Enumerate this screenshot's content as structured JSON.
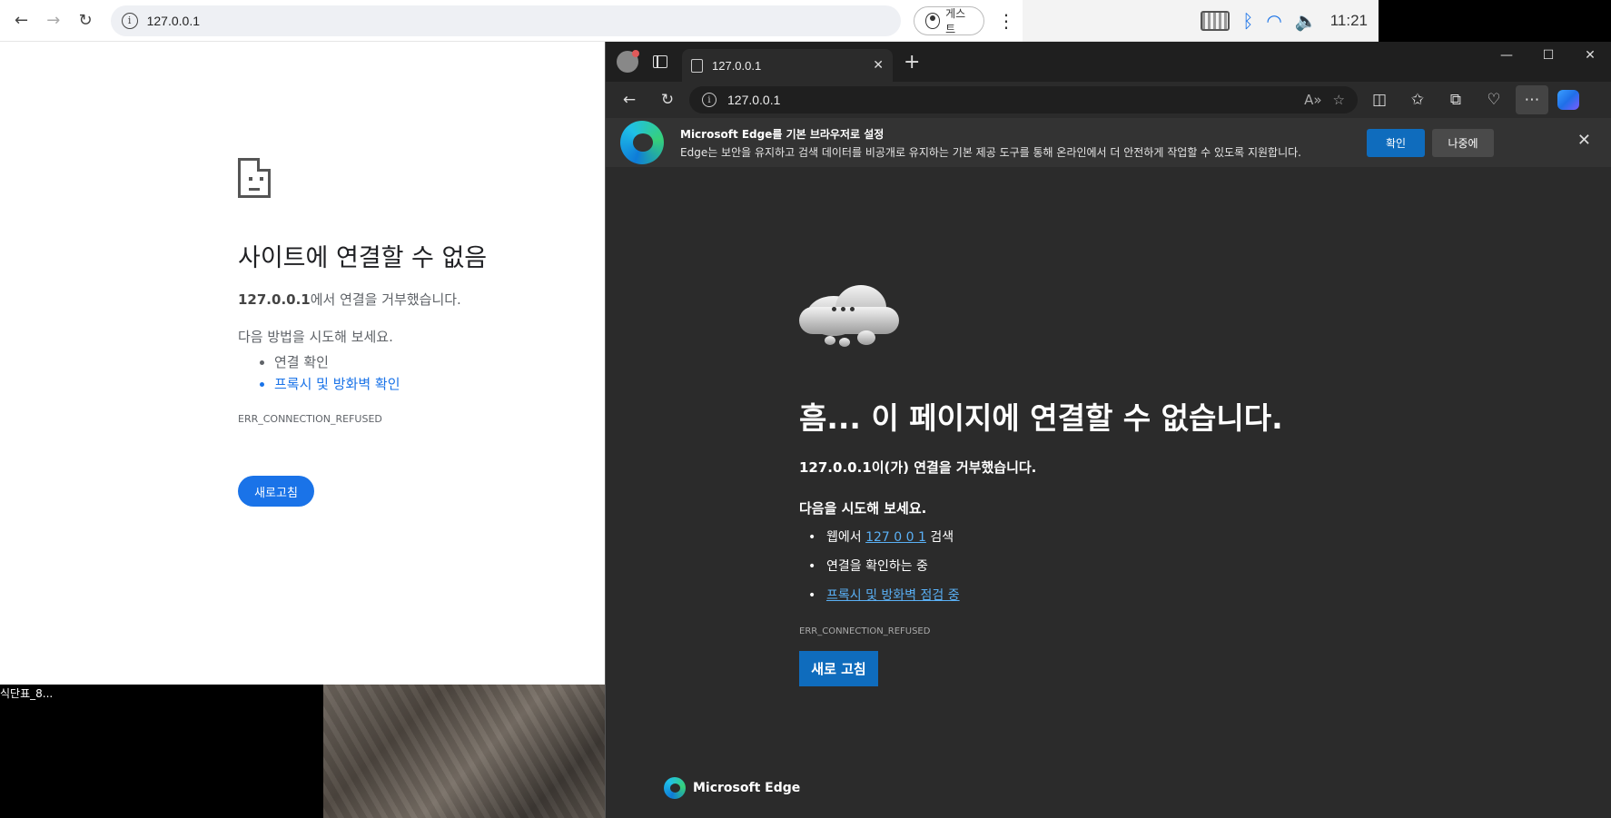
{
  "desktop": {
    "file_label": "식단표_8..."
  },
  "tray": {
    "time": "11:21"
  },
  "chrome": {
    "url": "127.0.0.1",
    "guest_label": "게스트",
    "error": {
      "title": "사이트에 연결할 수 없음",
      "host": "127.0.0.1",
      "desc_suffix": "에서 연결을 거부했습니다.",
      "try_label": "다음 방법을 시도해 보세요.",
      "suggestions": [
        "연결 확인",
        "프록시 및 방화벽 확인"
      ],
      "code": "ERR_CONNECTION_REFUSED",
      "reload_label": "새로고침"
    }
  },
  "edge": {
    "tab_title": "127.0.0.1",
    "url": "127.0.0.1",
    "banner": {
      "title": "Microsoft Edge를 기본 브라우저로 설정",
      "body": "Edge는 보안을 유지하고 검색 데이터를 비공개로 유지하는 기본 제공 도구를 통해 온라인에서 더 안전하게 작업할 수 있도록 지원합니다.",
      "ok_label": "확인",
      "later_label": "나중에"
    },
    "error": {
      "title": "흠... 이 페이지에 연결할 수 없습니다.",
      "desc": "127.0.0.1이(가) 연결을 거부했습니다.",
      "try_label": "다음을 시도해 보세요.",
      "search_prefix": "웹에서 ",
      "search_link": "127 0 0 1",
      "search_suffix": " 검색",
      "check_connection": "연결을 확인하는 중",
      "proxy_link": "프록시 및 방화벽 점검 중",
      "code": "ERR_CONNECTION_REFUSED",
      "reload_label": "새로 고침"
    },
    "footer_brand": "Microsoft Edge"
  },
  "colors": {
    "chrome_accent": "#1a73e8",
    "edge_accent": "#0f6cbd",
    "edge_bg": "#2b2b2b"
  }
}
